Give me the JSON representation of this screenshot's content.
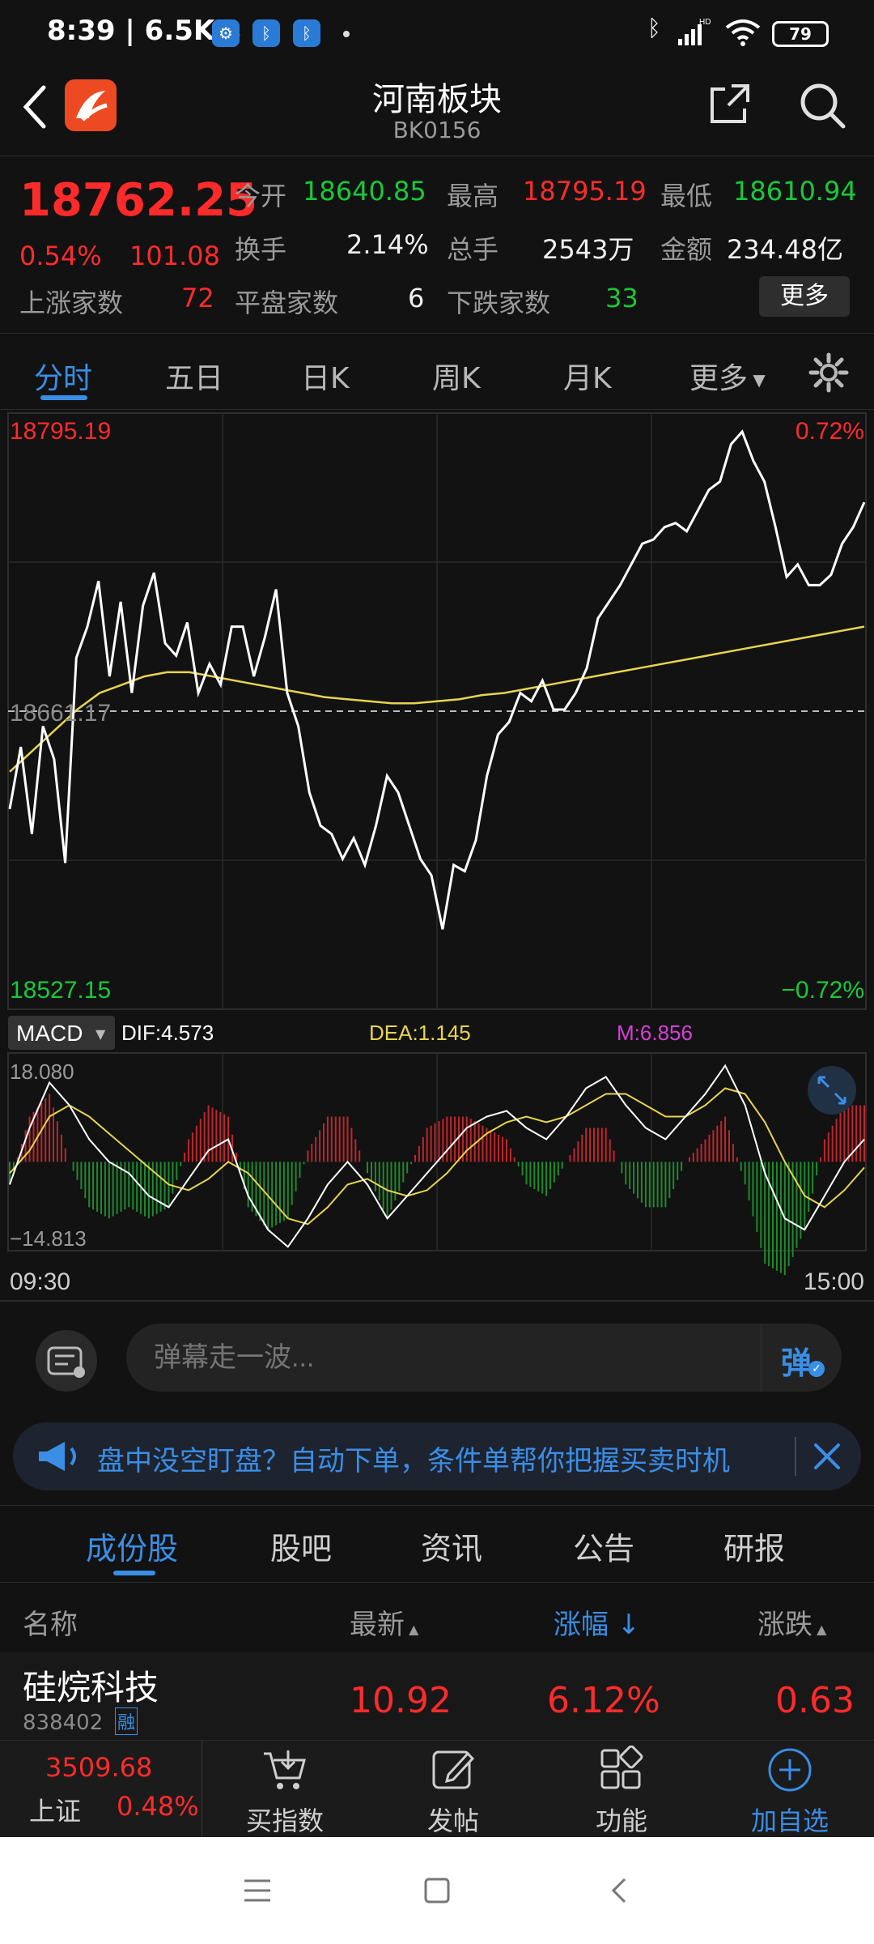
{
  "status_bar": {
    "time": "8:39",
    "speed": "6.5K/s",
    "battery": "79"
  },
  "header": {
    "title": "河南板块",
    "code": "BK0156"
  },
  "quote": {
    "price": "18762.25",
    "change_pct": "0.54%",
    "change": "101.08",
    "open_label": "今开",
    "open": "18640.85",
    "high_label": "最高",
    "high": "18795.19",
    "low_label": "最低",
    "low": "18610.94",
    "turnover_label": "换手",
    "turnover": "2.14%",
    "volume_label": "总手",
    "volume": "2543万",
    "amount_label": "金额",
    "amount": "234.48亿",
    "up_label": "上涨家数",
    "up": "72",
    "flat_label": "平盘家数",
    "flat": "6",
    "down_label": "下跌家数",
    "down": "33",
    "more_button": "更多"
  },
  "period_tabs": [
    "分时",
    "五日",
    "日K",
    "周K",
    "月K",
    "更多"
  ],
  "active_period": "分时",
  "chart_labels": {
    "max": "18795.19",
    "max_pct": "0.72%",
    "ref": "18661.17",
    "min": "18527.15",
    "min_pct": "−0.72%",
    "macd_select": "MACD",
    "dif": "DIF:4.573",
    "dea": "DEA:1.145",
    "m": "M:6.856",
    "macd_max": "18.080",
    "macd_min": "−14.813",
    "time_start": "09:30",
    "time_end": "15:00"
  },
  "chart_data": [
    {
      "type": "line",
      "title": "",
      "x_range": [
        "09:30",
        "15:00"
      ],
      "ylim": [
        18527.15,
        18795.19
      ],
      "reference": 18661.17,
      "series": [
        {
          "name": "",
          "color": "#ffffff",
          "values": [
            18612,
            18642,
            18600,
            18652,
            18636,
            18586,
            18685,
            18700,
            18722,
            18676,
            18712,
            18668,
            18710,
            18726,
            18692,
            18686,
            18702,
            18668,
            18682,
            18672,
            18700,
            18700,
            18676,
            18695,
            18718,
            18668,
            18652,
            18620,
            18604,
            18600,
            18588,
            18598,
            18585,
            18604,
            18628,
            18620,
            18604,
            18588,
            18580,
            18554,
            18585,
            18582,
            18597,
            18628,
            18648,
            18654,
            18668,
            18664,
            18674,
            18660,
            18660,
            18668,
            18680,
            18704,
            18712,
            18720,
            18730,
            18740,
            18742,
            18748,
            18750,
            18746,
            18756,
            18766,
            18770,
            18788,
            18794,
            18780,
            18770,
            18748,
            18724,
            18730,
            18720,
            18720,
            18725,
            18740,
            18748,
            18760
          ]
        },
        {
          "name": "",
          "color": "#e8d44d",
          "values": [
            18630,
            18640,
            18650,
            18660,
            18668,
            18672,
            18676,
            18678,
            18678,
            18676,
            18674,
            18672,
            18670,
            18668,
            18666,
            18665,
            18664,
            18663,
            18663,
            18664,
            18665,
            18667,
            18668,
            18670,
            18672,
            18674,
            18676,
            18678,
            18680,
            18682,
            18684,
            18686,
            18688,
            18690,
            18692,
            18694,
            18696,
            18698,
            18700
          ]
        }
      ]
    },
    {
      "type": "bar",
      "title": "MACD",
      "ylim": [
        -14.813,
        18.08
      ],
      "series": [
        {
          "name": "DIF",
          "color": "#ffffff",
          "values": [
            -4,
            6,
            14,
            10,
            4,
            0,
            -2,
            -6,
            -8,
            -3,
            2,
            4,
            -6,
            -12,
            -15,
            -10,
            -4,
            0,
            -4,
            -10,
            -6,
            -2,
            2,
            6,
            8,
            9,
            6,
            4,
            8,
            13,
            15,
            10,
            6,
            4,
            8,
            12,
            17,
            10,
            -2,
            -10,
            -12,
            -6,
            0,
            4
          ]
        },
        {
          "name": "DEA",
          "color": "#e8d44d",
          "values": [
            -2,
            2,
            8,
            10,
            8,
            5,
            2,
            -1,
            -4,
            -5,
            -3,
            0,
            -2,
            -6,
            -10,
            -11,
            -8,
            -4,
            -3,
            -5,
            -6,
            -5,
            -2,
            2,
            5,
            7,
            8,
            7,
            8,
            10,
            12,
            12,
            10,
            8,
            8,
            10,
            13,
            12,
            7,
            0,
            -6,
            -8,
            -5,
            -1
          ]
        },
        {
          "name": "M",
          "color": "",
          "values": [
            -4,
            8,
            12,
            0,
            -8,
            -10,
            -8,
            -10,
            -8,
            4,
            10,
            8,
            -8,
            -12,
            -10,
            2,
            8,
            8,
            -2,
            -10,
            -2,
            6,
            8,
            8,
            6,
            4,
            -4,
            -6,
            0,
            6,
            6,
            -4,
            -8,
            -8,
            0,
            4,
            8,
            -4,
            -18,
            -20,
            -12,
            4,
            10,
            10
          ]
        }
      ]
    }
  ],
  "comment": {
    "placeholder": "弹幕走一波...",
    "danmu_label": "弹"
  },
  "banner": {
    "text": "盘中没空盯盘？自动下单，条件单帮你把握买卖时机"
  },
  "stock_tabs": [
    "成份股",
    "股吧",
    "资讯",
    "公告",
    "研报"
  ],
  "active_stock_tab": "成份股",
  "table": {
    "headers": {
      "name": "名称",
      "latest": "最新",
      "pct": "涨幅",
      "change": "涨跌"
    },
    "rows": [
      {
        "name": "硅烷科技",
        "code": "838402",
        "tag": "融",
        "latest": "10.92",
        "pct": "6.12%",
        "change": "0.63"
      }
    ]
  },
  "bottom_nav": {
    "index_value": "3509.68",
    "index_name": "上证",
    "index_pct": "0.48%",
    "items": [
      "买指数",
      "发帖",
      "功能",
      "加自选"
    ]
  }
}
